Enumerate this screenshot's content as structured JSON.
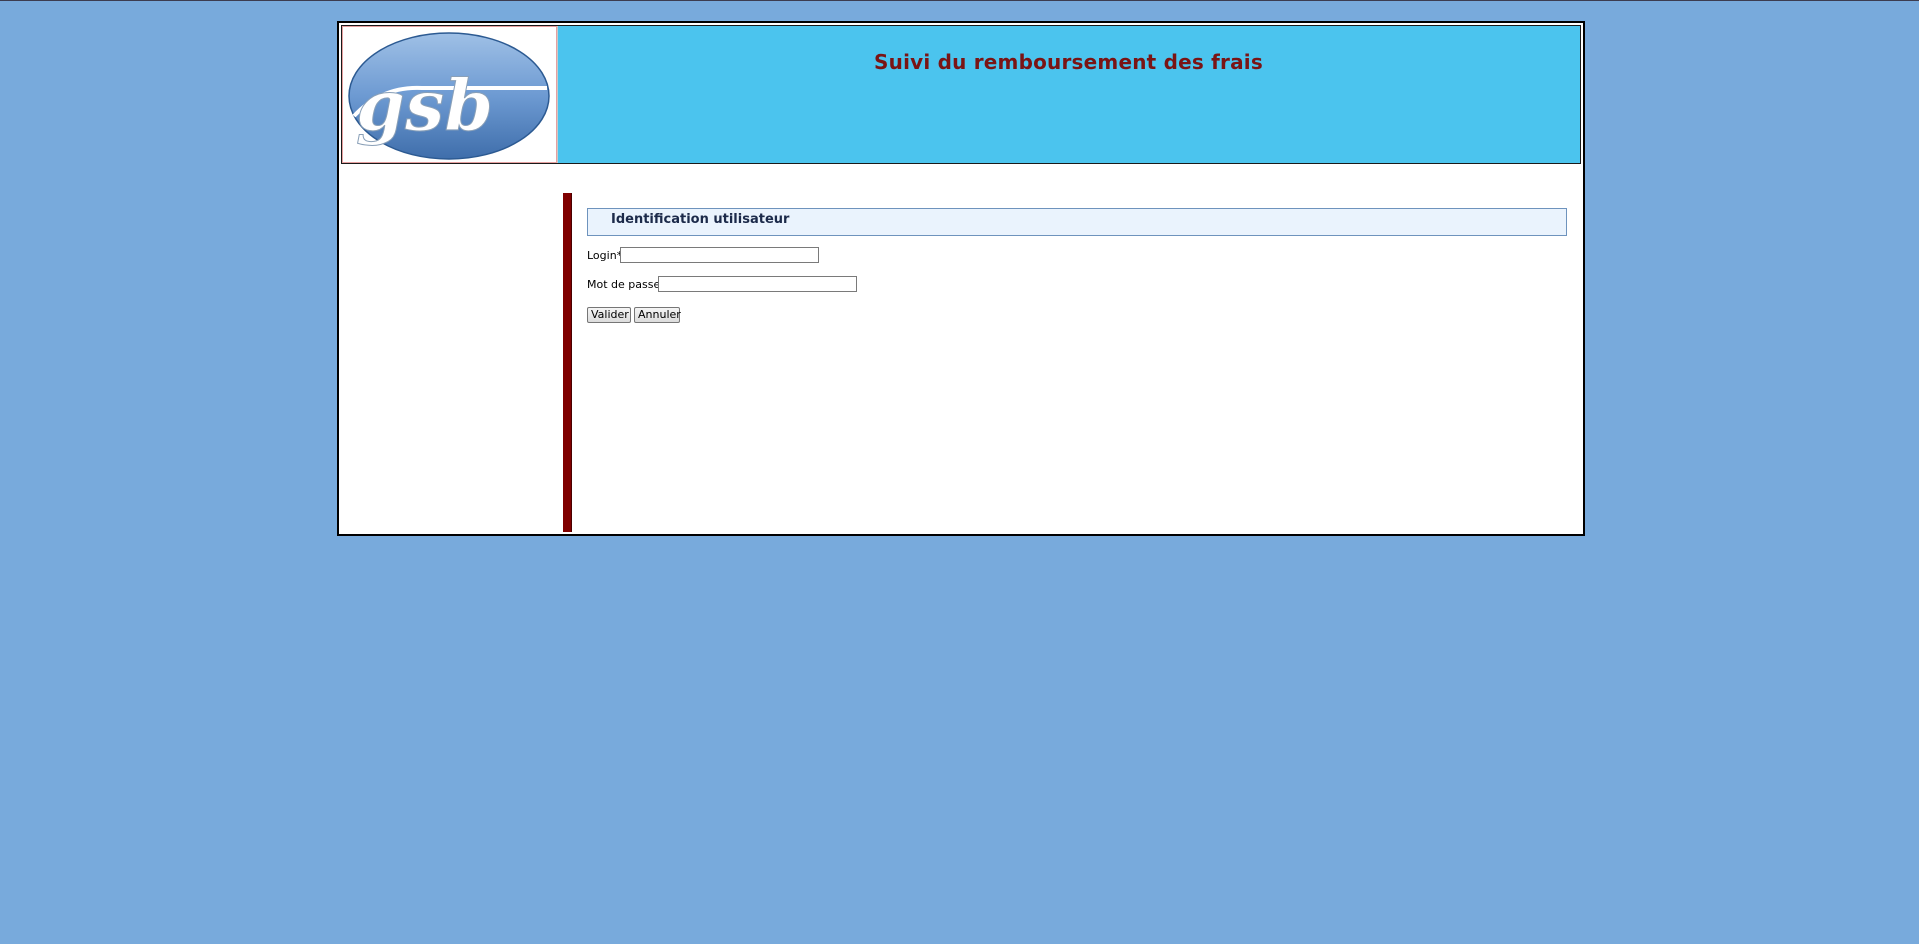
{
  "header": {
    "title": "Suivi du remboursement des frais",
    "logo": {
      "text": "gsb",
      "icon": "gsb-logo"
    }
  },
  "form": {
    "title": "Identification utilisateur",
    "login_label": "Login*",
    "login_value": "",
    "password_label": "Mot de passe*",
    "password_value": "",
    "submit_label": "Valider",
    "cancel_label": "Annuler"
  },
  "colors": {
    "background": "#78aadc",
    "header": "#4bc4ee",
    "title": "#7a1414",
    "divider": "#800000"
  }
}
